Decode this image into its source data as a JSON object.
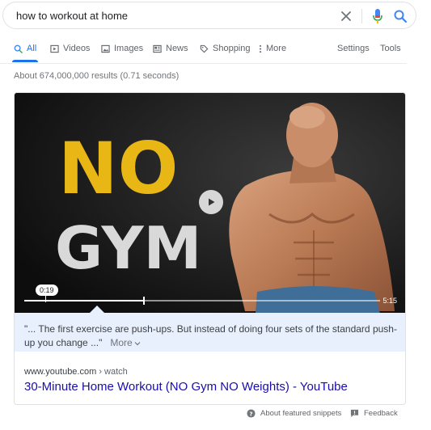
{
  "search": {
    "query": "how to workout at home",
    "clear_icon": "close-icon",
    "mic_icon": "microphone-icon",
    "search_icon": "search-icon"
  },
  "tabs": [
    {
      "label": "All",
      "icon": "search-icon",
      "active": true
    },
    {
      "label": "Videos",
      "icon": "video-icon"
    },
    {
      "label": "Images",
      "icon": "image-icon"
    },
    {
      "label": "News",
      "icon": "newspaper-icon"
    },
    {
      "label": "Shopping",
      "icon": "tag-icon"
    },
    {
      "label": "More",
      "icon": "more-vert-icon"
    }
  ],
  "tools": {
    "settings": "Settings",
    "tools": "Tools"
  },
  "result_stats": "About 674,000,000 results (0.71 seconds)",
  "video": {
    "thumbnail_text_line1": "NO",
    "thumbnail_text_line2": "GYM",
    "current_time": "0:19",
    "duration": "5:15"
  },
  "snippet": {
    "text": "\"... The first exercise are push-ups. But instead of doing four sets of the standard push-up you change ...\"",
    "more_label": "More"
  },
  "result": {
    "domain": "www.youtube.com",
    "path": " › watch",
    "title": "30-Minute Home Workout (NO Gym NO Weights) - YouTube"
  },
  "footer": {
    "about_snippets": "About featured snippets",
    "feedback": "Feedback"
  },
  "colors": {
    "accent": "#1a73e8",
    "link": "#1a0dab",
    "snippet_bg": "#e8f0fe",
    "thumb_yellow": "#e8b716"
  }
}
